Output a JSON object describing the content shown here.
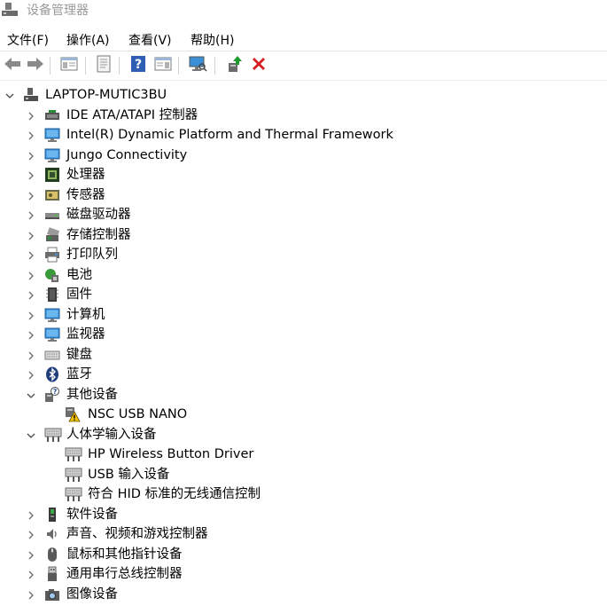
{
  "window": {
    "title": "设备管理器"
  },
  "menu": [
    {
      "label": "文件(F)"
    },
    {
      "label": "操作(A)"
    },
    {
      "label": "查看(V)"
    },
    {
      "label": "帮助(H)"
    }
  ],
  "toolbar": [
    {
      "icon": "back-arrow-icon",
      "name": "back-button"
    },
    {
      "icon": "forward-arrow-icon",
      "name": "forward-button"
    },
    {
      "icon": "console-tree-icon",
      "name": "show-hide-console-tree-button"
    },
    {
      "icon": "properties-icon",
      "name": "properties-button"
    },
    {
      "icon": "help-icon",
      "name": "help-button"
    },
    {
      "icon": "action-pane-icon",
      "name": "show-action-pane-button"
    },
    {
      "icon": "scan-hardware-icon",
      "name": "scan-hardware-button"
    },
    {
      "icon": "update-driver-icon",
      "name": "update-driver-button"
    },
    {
      "icon": "uninstall-x-icon",
      "name": "uninstall-device-button"
    }
  ],
  "tree": {
    "root": {
      "label": "LAPTOP-MUTIC3BU",
      "icon": "computer-root-icon",
      "expanded": true
    },
    "items": [
      {
        "label": "IDE ATA/ATAPI 控制器",
        "icon": "ide-controller-icon",
        "level": 1,
        "expander": "collapsed"
      },
      {
        "label": "Intel(R) Dynamic Platform and Thermal Framework",
        "icon": "monitor-icon",
        "level": 1,
        "expander": "collapsed"
      },
      {
        "label": "Jungo Connectivity",
        "icon": "monitor-icon",
        "level": 1,
        "expander": "collapsed"
      },
      {
        "label": "处理器",
        "icon": "processor-icon",
        "level": 1,
        "expander": "collapsed"
      },
      {
        "label": "传感器",
        "icon": "sensor-icon",
        "level": 1,
        "expander": "collapsed"
      },
      {
        "label": "磁盘驱动器",
        "icon": "disk-drive-icon",
        "level": 1,
        "expander": "collapsed"
      },
      {
        "label": "存储控制器",
        "icon": "storage-controller-icon",
        "level": 1,
        "expander": "collapsed"
      },
      {
        "label": "打印队列",
        "icon": "printer-icon",
        "level": 1,
        "expander": "collapsed"
      },
      {
        "label": "电池",
        "icon": "battery-icon",
        "level": 1,
        "expander": "collapsed"
      },
      {
        "label": "固件",
        "icon": "firmware-icon",
        "level": 1,
        "expander": "collapsed"
      },
      {
        "label": "计算机",
        "icon": "monitor-icon",
        "level": 1,
        "expander": "collapsed"
      },
      {
        "label": "监视器",
        "icon": "monitor-icon",
        "level": 1,
        "expander": "collapsed"
      },
      {
        "label": "键盘",
        "icon": "keyboard-icon",
        "level": 1,
        "expander": "collapsed"
      },
      {
        "label": "蓝牙",
        "icon": "bluetooth-icon",
        "level": 1,
        "expander": "collapsed"
      },
      {
        "label": "其他设备",
        "icon": "unknown-device-icon",
        "level": 1,
        "expander": "expanded"
      },
      {
        "label": "NSC USB NANO",
        "icon": "warning-device-icon",
        "level": 2,
        "expander": "none"
      },
      {
        "label": "人体学输入设备",
        "icon": "hid-icon",
        "level": 1,
        "expander": "expanded"
      },
      {
        "label": "HP Wireless Button Driver",
        "icon": "hid-icon",
        "level": 2,
        "expander": "none"
      },
      {
        "label": "USB 输入设备",
        "icon": "hid-icon",
        "level": 2,
        "expander": "none"
      },
      {
        "label": "符合 HID 标准的无线通信控制",
        "icon": "hid-icon",
        "level": 2,
        "expander": "none"
      },
      {
        "label": "软件设备",
        "icon": "software-device-icon",
        "level": 1,
        "expander": "collapsed"
      },
      {
        "label": "声音、视频和游戏控制器",
        "icon": "sound-icon",
        "level": 1,
        "expander": "collapsed"
      },
      {
        "label": "鼠标和其他指针设备",
        "icon": "mouse-icon",
        "level": 1,
        "expander": "collapsed"
      },
      {
        "label": "通用串行总线控制器",
        "icon": "usb-icon",
        "level": 1,
        "expander": "collapsed"
      },
      {
        "label": "图像设备",
        "icon": "camera-icon",
        "level": 1,
        "expander": "collapsed"
      }
    ]
  }
}
